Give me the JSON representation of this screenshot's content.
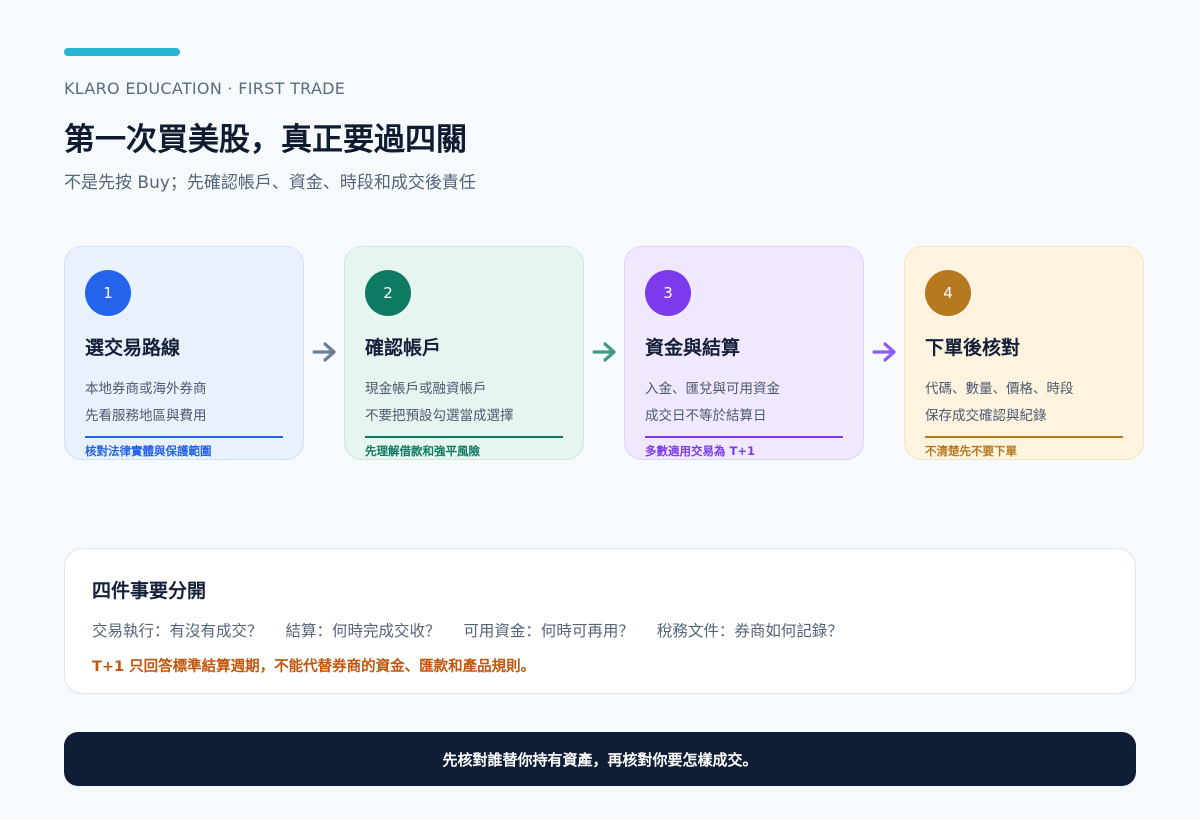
{
  "header": {
    "eyebrow": "KLARO EDUCATION · FIRST TRADE",
    "title": "第一次買美股，真正要過四關",
    "subtitle": "不是先按 Buy；先確認帳戶、資金、時段和成交後責任"
  },
  "steps": [
    {
      "number": "1",
      "title": "選交易路線",
      "lines": [
        "本地券商或海外券商",
        "先看服務地區與費用"
      ],
      "note": "核對法律實體與保護範圍",
      "colors": {
        "bg": "#e9f1fc",
        "border": "#d2e1f5",
        "accent": "#2563eb"
      }
    },
    {
      "number": "2",
      "title": "確認帳戶",
      "lines": [
        "現金帳戶或融資帳戶",
        "不要把預設勾選當成選擇"
      ],
      "note": "先理解借款和強平風險",
      "colors": {
        "bg": "#e6f5f0",
        "border": "#cde8de",
        "accent": "#0f7a62"
      }
    },
    {
      "number": "3",
      "title": "資金與結算",
      "lines": [
        "入金、匯兌與可用資金",
        "成交日不等於結算日"
      ],
      "note": "多數適用交易為 T+1",
      "colors": {
        "bg": "#f0e8fc",
        "border": "#e0d2f5",
        "accent": "#7c3aed"
      }
    },
    {
      "number": "4",
      "title": "下單後核對",
      "lines": [
        "代碼、數量、價格、時段",
        "保存成交確認與紀錄"
      ],
      "note": "不清楚先不要下單",
      "colors": {
        "bg": "#fdf3de",
        "border": "#f2e3c2",
        "accent": "#b7791f"
      }
    }
  ],
  "arrow_colors": [
    "#6b7f99",
    "#3f9a86",
    "#8b5cf6"
  ],
  "panel": {
    "title": "四件事要分開",
    "questions": [
      "交易執行：有沒有成交？",
      "結算：何時完成交收？",
      "可用資金：何時可再用？",
      "稅務文件：券商如何記錄？"
    ],
    "warning": "T+1 只回答標準結算週期，不能代替券商的資金、匯款和產品規則。"
  },
  "footer": {
    "text": "先核對誰替你持有資產，再核對你要怎樣成交。"
  }
}
